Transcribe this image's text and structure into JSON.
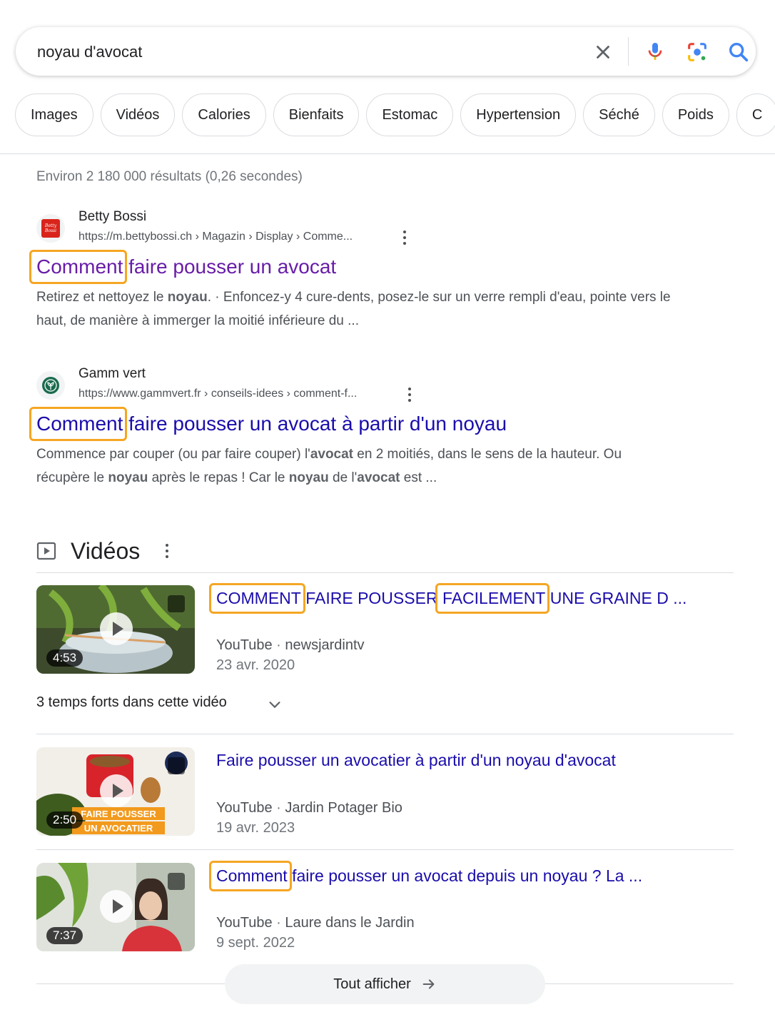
{
  "search": {
    "query": "noyau d'avocat"
  },
  "chips": [
    "Images",
    "Vidéos",
    "Calories",
    "Bienfaits",
    "Estomac",
    "Hypertension",
    "Séché",
    "Poids",
    "C"
  ],
  "stats": "Environ 2 180 000 résultats (0,26 secondes)",
  "results": [
    {
      "site": "Betty Bossi",
      "url": "https://m.bettybossi.ch › Magazin › Display › Comme...",
      "title_highlight": "Comment",
      "title_rest": " faire pousser un avocat",
      "snippet_1": "Retirez et nettoyez le ",
      "snippet_b1": "noyau",
      "snippet_2": ". · Enfoncez-y 4 cure-dents, posez-le sur un verre rempli d'eau, pointe vers le haut, de manière à immerger la moitié inférieure du ...",
      "favicon_text": "Betty Bossi"
    },
    {
      "site": "Gamm vert",
      "url": "https://www.gammvert.fr › conseils-idees › comment-f...",
      "title_highlight": "Comment",
      "title_rest": " faire pousser un avocat à partir d'un noyau",
      "s1": "Commence par couper (ou par faire couper) l'",
      "b1": "avocat",
      "s2": " en 2 moitiés, dans le sens de la hauteur. Ou récupère le ",
      "b2": "noyau",
      "s3": " après le repas ! Car le ",
      "b3": "noyau",
      "s4": " de l'",
      "b4": "avocat",
      "s5": " est ..."
    }
  ],
  "videos": {
    "heading": "Vidéos",
    "items": [
      {
        "t1": "COMMENT",
        "t2": " FAIRE POUSSER ",
        "t3": "FACILEMENT",
        "t4": " UNE GRAINE D ...",
        "platform": "YouTube",
        "channel": "newsjardintv",
        "date": "23 avr. 2020",
        "duration": "4:53"
      },
      {
        "title": "Faire pousser un avocatier à partir d'un noyau d'avocat",
        "platform": "YouTube",
        "channel": "Jardin Potager Bio",
        "date": "19 avr. 2023",
        "duration": "2:50",
        "thumb_line1": "FAIRE POUSSER",
        "thumb_line2": "UN AVOCATIER"
      },
      {
        "t1": "Comment",
        "t2": " faire pousser un avocat depuis un noyau ? La ...",
        "platform": "YouTube",
        "channel": "Laure dans le Jardin",
        "date": "9 sept. 2022",
        "duration": "7:37"
      }
    ],
    "moments": "3 temps forts dans cette vidéo",
    "see_all": "Tout afficher"
  },
  "colors": {
    "link": "#1a0dab",
    "visited": "#681da8",
    "highlight": "#f5a623"
  }
}
